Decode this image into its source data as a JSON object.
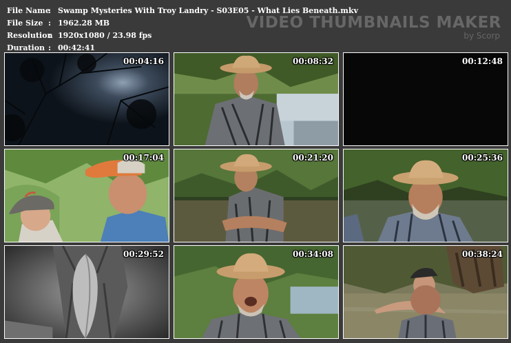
{
  "info": {
    "file_name_label": "File Name",
    "file_name": "Swamp Mysteries With Troy Landry - S03E05 - What Lies Beneath.mkv",
    "file_size_label": "File Size",
    "file_size": "1962.28 MB",
    "resolution_label": "Resolution",
    "resolution": "1920x1080 / 23.98 fps",
    "duration_label": "Duration",
    "duration": "00:42:41",
    "separator": ":"
  },
  "brand": {
    "title": "VIDEO THUMBNAILS MAKER",
    "subtitle": "by Scorp"
  },
  "thumbnails": [
    {
      "timestamp": "00:04:16",
      "scene": "dark-tree-night-sky"
    },
    {
      "timestamp": "00:08:32",
      "scene": "man-cowboy-hat-river"
    },
    {
      "timestamp": "00:12:48",
      "scene": "black-frame"
    },
    {
      "timestamp": "00:17:04",
      "scene": "boy-and-man-in-caps"
    },
    {
      "timestamp": "00:21:20",
      "scene": "man-arms-crossed-swamp"
    },
    {
      "timestamp": "00:25:36",
      "scene": "bearded-man-cowboy-hat"
    },
    {
      "timestamp": "00:29:52",
      "scene": "monochrome-fish-catch"
    },
    {
      "timestamp": "00:34:08",
      "scene": "man-laughing-cowboy-hat"
    },
    {
      "timestamp": "00:38:24",
      "scene": "men-wading-swamp"
    }
  ]
}
